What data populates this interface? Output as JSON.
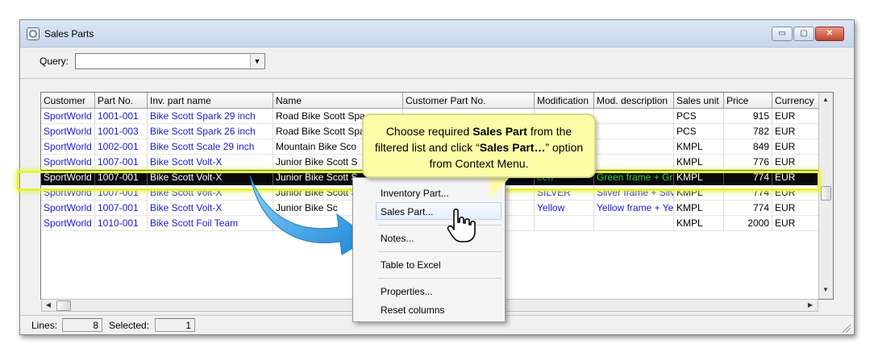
{
  "window": {
    "title": "Sales Parts",
    "min_glyph": "▭",
    "max_glyph": "▢",
    "close_glyph": "✕"
  },
  "query": {
    "label": "Query:",
    "value": ""
  },
  "table": {
    "columns": [
      "Customer",
      "Part No.",
      "Inv. part name",
      "Name",
      "Customer Part No.",
      "Modification",
      "Mod. description",
      "Sales unit",
      "Price",
      "Currency"
    ],
    "rows": [
      [
        "SportWorld",
        "1001-001",
        "Bike Scott Spark 29 inch",
        "Road Bike Scott Spa",
        "",
        "",
        "",
        "PCS",
        "915",
        "EUR"
      ],
      [
        "SportWorld",
        "1001-003",
        "Bike Scott Spark 26 inch",
        "Road Bike Scott Spa",
        "",
        "",
        "",
        "PCS",
        "782",
        "EUR"
      ],
      [
        "SportWorld",
        "1002-001",
        "Bike Scott Scale 29 inch",
        "Mountain Bike Sco",
        "",
        "",
        "",
        "KMPL",
        "849",
        "EUR"
      ],
      [
        "SportWorld",
        "1007-001",
        "Bike Scott Volt-X",
        "Junior Bike Scott S",
        "",
        "",
        "",
        "KMPL",
        "776",
        "EUR"
      ],
      [
        "SportWorld",
        "1007-001",
        "Bike Scott Volt-X",
        "Junior Bike Scott S",
        "",
        "een",
        "Green frame + Gre",
        "KMPL",
        "774",
        "EUR"
      ],
      [
        "SportWorld",
        "1007-001",
        "Bike Scott Volt-X",
        "Junior Bike Scott S",
        "",
        "SILVER",
        "Silver frame + Silve",
        "KMPL",
        "774",
        "EUR"
      ],
      [
        "SportWorld",
        "1007-001",
        "Bike Scott Volt-X",
        "Junior Bike Sc",
        "",
        "Yellow",
        "Yellow frame + Yel",
        "KMPL",
        "774",
        "EUR"
      ],
      [
        "SportWorld",
        "1010-001",
        "Bike Scott Foil Team",
        "Bik",
        "",
        "",
        "",
        "KMPL",
        "2000",
        "EUR"
      ]
    ],
    "selected_row_index": 4
  },
  "status": {
    "lines_label": "Lines:",
    "lines_value": "8",
    "selected_label": "Selected:",
    "selected_value": "1"
  },
  "context_menu": {
    "items": [
      "Inventory Part...",
      "Sales Part...",
      "Notes...",
      "Table to Excel",
      "Properties...",
      "Reset columns"
    ],
    "hovered": "Sales Part..."
  },
  "callout": {
    "part1": "Choose required ",
    "bold1": "Sales Part",
    "part2": " from the filtered list and click “",
    "bold2": "Sales Part…",
    "part3": "” option from Context Menu."
  },
  "colors": {
    "link_blue": "#1a1ad0",
    "selection_bg": "#0a0a0a",
    "highlight_yellow": "#e6f23a",
    "callout_bg": "#fdfda8",
    "arrow_blue": "#2aa3e8"
  },
  "icons": {
    "cursor": "hand-pointer-icon",
    "app": "gear-icon",
    "arrow": "curved-arrow-icon"
  }
}
